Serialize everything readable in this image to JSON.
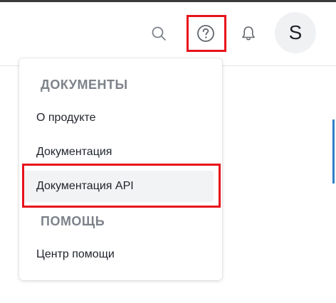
{
  "header": {
    "search_icon": "search-icon",
    "help_icon": "help-icon",
    "bell_icon": "bell-icon",
    "avatar_letter": "S"
  },
  "menu": {
    "sections": [
      {
        "title": "ДОКУМЕНТЫ",
        "items": [
          "О продукте",
          "Документация",
          "Документация API"
        ]
      },
      {
        "title": "ПОМОЩЬ",
        "items": [
          "Центр помощи"
        ]
      }
    ],
    "selected_item": "Документация API"
  },
  "colors": {
    "highlight": "#e8121c",
    "section_title": "#7d828a",
    "selected_bg": "#f2f3f5",
    "accent": "#2f80c8"
  }
}
